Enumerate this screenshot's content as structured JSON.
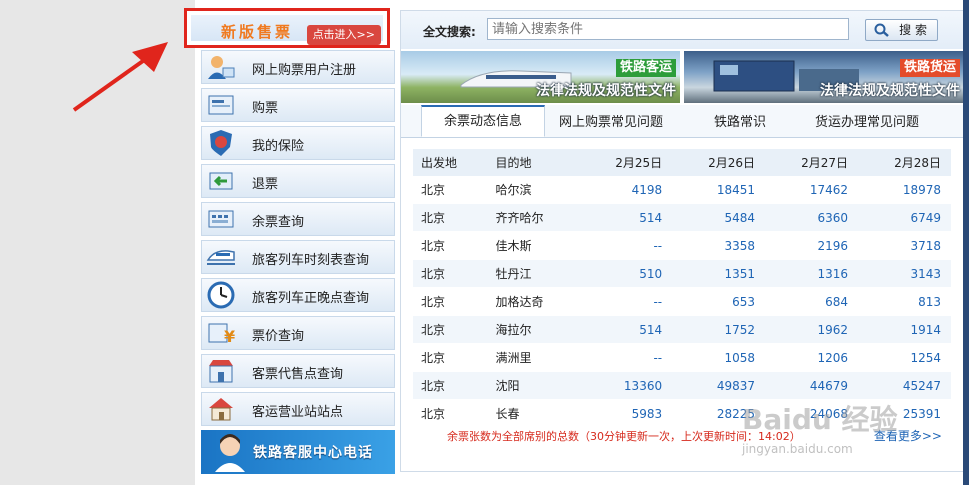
{
  "new_banner": {
    "title": "新版售票",
    "enter": "点击进入>>"
  },
  "menu": [
    {
      "label": "网上购票用户注册",
      "icon": "user-register-icon"
    },
    {
      "label": "购票",
      "icon": "ticket-icon"
    },
    {
      "label": "我的保险",
      "icon": "insurance-shield-icon"
    },
    {
      "label": "退票",
      "icon": "refund-arrow-icon"
    },
    {
      "label": "余票查询",
      "icon": "remaining-ticket-icon"
    },
    {
      "label": "旅客列车时刻表查询",
      "icon": "train-icon"
    },
    {
      "label": "旅客列车正晚点查询",
      "icon": "clock-icon"
    },
    {
      "label": "票价查询",
      "icon": "price-icon"
    },
    {
      "label": "客票代售点查询",
      "icon": "shop-icon"
    },
    {
      "label": "客运营业站站点",
      "icon": "station-house-icon"
    }
  ],
  "hotline": {
    "label": "铁路客服中心电话"
  },
  "search": {
    "label": "全文搜索:",
    "placeholder": "请输入搜索条件",
    "button": "搜 索"
  },
  "banners": [
    {
      "tag": "铁路客运",
      "sub": "法律法规及规范性文件"
    },
    {
      "tag": "铁路货运",
      "sub": "法律法规及规范性文件"
    }
  ],
  "tabs": [
    "余票动态信息",
    "网上购票常见问题",
    "铁路常识",
    "货运办理常见问题"
  ],
  "table": {
    "headers": [
      "出发地",
      "目的地",
      "2月25日",
      "2月26日",
      "2月27日",
      "2月28日"
    ],
    "rows": [
      [
        "北京",
        "哈尔滨",
        "4198",
        "18451",
        "17462",
        "18978"
      ],
      [
        "北京",
        "齐齐哈尔",
        "514",
        "5484",
        "6360",
        "6749"
      ],
      [
        "北京",
        "佳木斯",
        "--",
        "3358",
        "2196",
        "3718"
      ],
      [
        "北京",
        "牡丹江",
        "510",
        "1351",
        "1316",
        "3143"
      ],
      [
        "北京",
        "加格达奇",
        "--",
        "653",
        "684",
        "813"
      ],
      [
        "北京",
        "海拉尔",
        "514",
        "1752",
        "1962",
        "1914"
      ],
      [
        "北京",
        "满洲里",
        "--",
        "1058",
        "1206",
        "1254"
      ],
      [
        "北京",
        "沈阳",
        "13360",
        "49837",
        "44679",
        "45247"
      ],
      [
        "北京",
        "长春",
        "5983",
        "28225",
        "24068",
        "25391"
      ]
    ]
  },
  "note": "余票张数为全部席别的总数（30分钟更新一次，上次更新时间：14:02）",
  "more": "查看更多>>",
  "watermark": {
    "main": "Baidu 经验",
    "sub": "jingyan.baidu.com"
  },
  "colors": {
    "accent": "#1f65b5",
    "highlight": "#e0251c",
    "note": "#d62a1d"
  }
}
